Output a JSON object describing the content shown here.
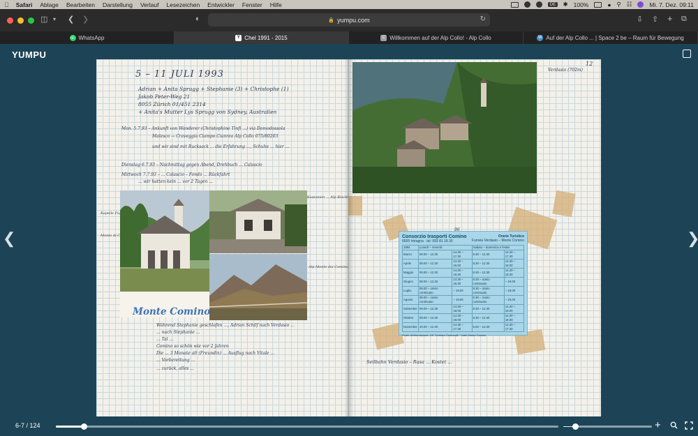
{
  "menubar": {
    "items": [
      "Safari",
      "Ablage",
      "Bearbeiten",
      "Darstellung",
      "Verlauf",
      "Lesezeichen",
      "Entwickler",
      "Fenster",
      "Hilfe"
    ],
    "battery": "100%",
    "keyboard": "DE",
    "datetime": "Mi. 7. Dez.  09:11"
  },
  "browser": {
    "url": "yumpu.com",
    "tabs": [
      {
        "label": "WhatsApp",
        "icon": "whatsapp-icon",
        "color": "#25d366"
      },
      {
        "label": "Chel 1991 - 2015",
        "icon": "yumpu-y-icon",
        "color": "#ffffff",
        "active": true
      },
      {
        "label": "Willkommen auf der Alp Collo! - Alp Collo",
        "icon": "site-icon",
        "color": "#9aa0a6"
      },
      {
        "label": "Auf der Alp Collo ... | Space 2 be – Raum für Bewegung",
        "icon": "wordpress-icon",
        "color": "#4a90c8"
      }
    ]
  },
  "viewer": {
    "brand": "YUMPU",
    "page_indicator": "6-7 / 124",
    "progress": 0.055,
    "zoom": 0.02
  },
  "notebook": {
    "left_page": {
      "heading": "5 – 11 JULI 1993",
      "entries": [
        "Adrian + Anita Sprugg + Stephanie (3) + Christophe (1)",
        "Jakob Peter-Weg 21",
        "8055 Zürich    01/451 2314",
        "+ Anita's Mutter Lys Sprugg von Sydney, Australien",
        "Mon. 5.7.93 – Ankunft von Wanderer (Christophine Tinfi ...) via Domodossola",
        "Malesco → Craveggia    Ciampo Cianrea  Alp Collo  075/80203",
        "und wir sind mit Rucksack ... die Erfahrung ..., Schuhe ... hier ...",
        "Dienstag 6.7.93 – Nachmittag gegen Abend, Drehbuch ... Calascio",
        "Mittwoch 7.7.93 – ... Calascio – Fondo ... Rückfahrt",
        "... wir hatten kein ... vor 2 Tagen ..."
      ],
      "margin_notes": [
        "Kapelle Pug-Alt",
        "Monte di Comino",
        "Kastanien ... Alp Rischli",
        "Alp Monte die Comino (Restaurant ...)"
      ],
      "photo_caption": "Monte Comino",
      "bottom_text": [
        "Während Stephanie geschlafen ..., Adrian Schilf nach Verdasio ...",
        "... nach Stephanie ...",
        "... Tal ...",
        "Comino so schön wie vor 2 Jahren",
        "Die ... 3 Monate alt (Freundin) ... Ausflug nach Vitale ...",
        "... Vorbereitung ...",
        "... zurück, alles ..."
      ]
    },
    "right_page": {
      "page_number": "12",
      "location_note": "Verdasio (702m)",
      "bottom_note": "Seilbahn Verdasio – Rasa ... Kostet ...",
      "ticket_number": "96",
      "timetable": {
        "company": "Consorzio trasporti Comino",
        "address": "6655 Intragna · tel. 093 81 18 30",
        "title": "Orario Turistico",
        "route": "Funivia Verdasio – Monte Comino",
        "year": "1994",
        "col_weekdays": "Lunedì – Venerdì",
        "col_weekend": "Sabato – domenica e festivi",
        "months": [
          "Marzo",
          "Aprile",
          "Maggio",
          "Giugno",
          "Luglio",
          "Agosto",
          "Settembre",
          "Ottobre",
          "Novembre"
        ],
        "weekday_morning": [
          "09.00 – 12.30",
          "09.00 – 12.30",
          "09.00 – 12.30",
          "09.00 – 12.30",
          "09.00 – orario continuato",
          "09.00 – orario continuato",
          "09.00 – 12.30",
          "09.00 – 12.30",
          "10.00 – 12.30"
        ],
        "weekday_afternoon": [
          "14.30 – 17.30",
          "14.30 – 18.00",
          "14.30 – 18.30",
          "14.30 – 18.30",
          "– 19.00",
          "– 19.00",
          "14.30 – 18.00",
          "14.30 – 18.00",
          "14.30 – 17.30"
        ],
        "weekend_morning": [
          "8.30 – 12.30",
          "8.30 – 12.30",
          "8.30 – 12.30",
          "8.30 – orario continuato",
          "8.30 – orario continuato",
          "8.30 – orario continuato",
          "8.30 – 12.30",
          "8.30 – 12.30",
          "9.00 – 12.30"
        ],
        "weekend_afternoon": [
          "14.30 – 17.30",
          "14.30 – 18.00",
          "14.30 – 18.30",
          "– 19.00",
          "– 19.00",
          "– 19.00",
          "14.30 – 18.00",
          "14.30 – 18.00",
          "14.30 – 17.30"
        ],
        "footer": "Punto d'informazione: Uff. Turistico Centovalli · Hotel Monte Comino"
      }
    }
  }
}
